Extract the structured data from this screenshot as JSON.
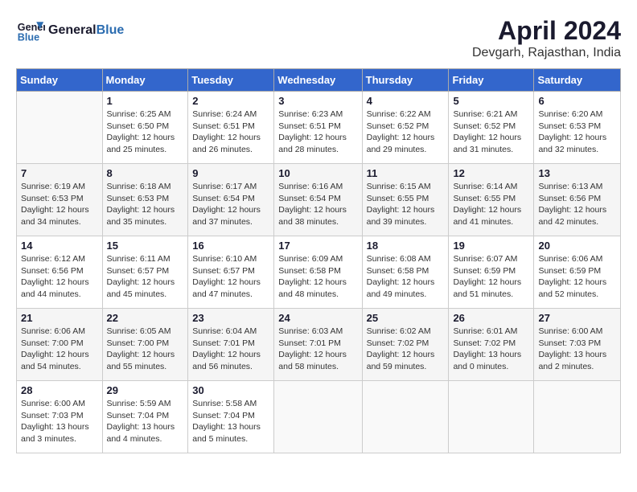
{
  "header": {
    "logo_general": "General",
    "logo_blue": "Blue",
    "month_title": "April 2024",
    "location": "Devgarh, Rajasthan, India"
  },
  "days_of_week": [
    "Sunday",
    "Monday",
    "Tuesday",
    "Wednesday",
    "Thursday",
    "Friday",
    "Saturday"
  ],
  "weeks": [
    [
      {
        "num": "",
        "info": ""
      },
      {
        "num": "1",
        "info": "Sunrise: 6:25 AM\nSunset: 6:50 PM\nDaylight: 12 hours\nand 25 minutes."
      },
      {
        "num": "2",
        "info": "Sunrise: 6:24 AM\nSunset: 6:51 PM\nDaylight: 12 hours\nand 26 minutes."
      },
      {
        "num": "3",
        "info": "Sunrise: 6:23 AM\nSunset: 6:51 PM\nDaylight: 12 hours\nand 28 minutes."
      },
      {
        "num": "4",
        "info": "Sunrise: 6:22 AM\nSunset: 6:52 PM\nDaylight: 12 hours\nand 29 minutes."
      },
      {
        "num": "5",
        "info": "Sunrise: 6:21 AM\nSunset: 6:52 PM\nDaylight: 12 hours\nand 31 minutes."
      },
      {
        "num": "6",
        "info": "Sunrise: 6:20 AM\nSunset: 6:53 PM\nDaylight: 12 hours\nand 32 minutes."
      }
    ],
    [
      {
        "num": "7",
        "info": "Sunrise: 6:19 AM\nSunset: 6:53 PM\nDaylight: 12 hours\nand 34 minutes."
      },
      {
        "num": "8",
        "info": "Sunrise: 6:18 AM\nSunset: 6:53 PM\nDaylight: 12 hours\nand 35 minutes."
      },
      {
        "num": "9",
        "info": "Sunrise: 6:17 AM\nSunset: 6:54 PM\nDaylight: 12 hours\nand 37 minutes."
      },
      {
        "num": "10",
        "info": "Sunrise: 6:16 AM\nSunset: 6:54 PM\nDaylight: 12 hours\nand 38 minutes."
      },
      {
        "num": "11",
        "info": "Sunrise: 6:15 AM\nSunset: 6:55 PM\nDaylight: 12 hours\nand 39 minutes."
      },
      {
        "num": "12",
        "info": "Sunrise: 6:14 AM\nSunset: 6:55 PM\nDaylight: 12 hours\nand 41 minutes."
      },
      {
        "num": "13",
        "info": "Sunrise: 6:13 AM\nSunset: 6:56 PM\nDaylight: 12 hours\nand 42 minutes."
      }
    ],
    [
      {
        "num": "14",
        "info": "Sunrise: 6:12 AM\nSunset: 6:56 PM\nDaylight: 12 hours\nand 44 minutes."
      },
      {
        "num": "15",
        "info": "Sunrise: 6:11 AM\nSunset: 6:57 PM\nDaylight: 12 hours\nand 45 minutes."
      },
      {
        "num": "16",
        "info": "Sunrise: 6:10 AM\nSunset: 6:57 PM\nDaylight: 12 hours\nand 47 minutes."
      },
      {
        "num": "17",
        "info": "Sunrise: 6:09 AM\nSunset: 6:58 PM\nDaylight: 12 hours\nand 48 minutes."
      },
      {
        "num": "18",
        "info": "Sunrise: 6:08 AM\nSunset: 6:58 PM\nDaylight: 12 hours\nand 49 minutes."
      },
      {
        "num": "19",
        "info": "Sunrise: 6:07 AM\nSunset: 6:59 PM\nDaylight: 12 hours\nand 51 minutes."
      },
      {
        "num": "20",
        "info": "Sunrise: 6:06 AM\nSunset: 6:59 PM\nDaylight: 12 hours\nand 52 minutes."
      }
    ],
    [
      {
        "num": "21",
        "info": "Sunrise: 6:06 AM\nSunset: 7:00 PM\nDaylight: 12 hours\nand 54 minutes."
      },
      {
        "num": "22",
        "info": "Sunrise: 6:05 AM\nSunset: 7:00 PM\nDaylight: 12 hours\nand 55 minutes."
      },
      {
        "num": "23",
        "info": "Sunrise: 6:04 AM\nSunset: 7:01 PM\nDaylight: 12 hours\nand 56 minutes."
      },
      {
        "num": "24",
        "info": "Sunrise: 6:03 AM\nSunset: 7:01 PM\nDaylight: 12 hours\nand 58 minutes."
      },
      {
        "num": "25",
        "info": "Sunrise: 6:02 AM\nSunset: 7:02 PM\nDaylight: 12 hours\nand 59 minutes."
      },
      {
        "num": "26",
        "info": "Sunrise: 6:01 AM\nSunset: 7:02 PM\nDaylight: 13 hours\nand 0 minutes."
      },
      {
        "num": "27",
        "info": "Sunrise: 6:00 AM\nSunset: 7:03 PM\nDaylight: 13 hours\nand 2 minutes."
      }
    ],
    [
      {
        "num": "28",
        "info": "Sunrise: 6:00 AM\nSunset: 7:03 PM\nDaylight: 13 hours\nand 3 minutes."
      },
      {
        "num": "29",
        "info": "Sunrise: 5:59 AM\nSunset: 7:04 PM\nDaylight: 13 hours\nand 4 minutes."
      },
      {
        "num": "30",
        "info": "Sunrise: 5:58 AM\nSunset: 7:04 PM\nDaylight: 13 hours\nand 5 minutes."
      },
      {
        "num": "",
        "info": ""
      },
      {
        "num": "",
        "info": ""
      },
      {
        "num": "",
        "info": ""
      },
      {
        "num": "",
        "info": ""
      }
    ]
  ]
}
